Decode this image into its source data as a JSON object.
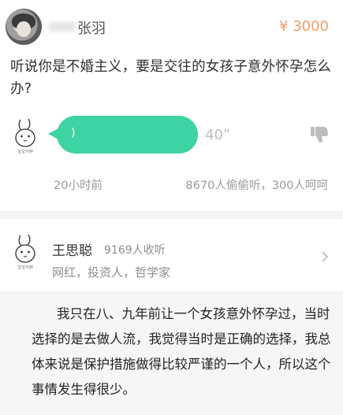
{
  "question_card": {
    "asker_name": "张羽",
    "price": "¥ 3000",
    "question_text": "听说你是不婚主义，要是交往的女孩子意外怀孕怎么办?",
    "mascot_caption": "宝宝不胖",
    "voice_duration": "40”",
    "time_ago": "20小时前",
    "stats": "8670人偷偷听，300人呵呵",
    "colors": {
      "bubble": "#3ed3a3",
      "price": "#f39c6b"
    }
  },
  "answerer": {
    "name": "王思聪",
    "followers": "9169人收听",
    "tags": "网红，投资人，哲学家",
    "mascot_caption": "宝宝不胖"
  },
  "answer": {
    "text": "我只在八、九年前让一个女孩意外怀孕过，当时选择的是去做人流，我觉得当时是正确的选择，我总体来说是保护措施做得比较严谨的一个人，所以这个事情发生得很少。"
  }
}
